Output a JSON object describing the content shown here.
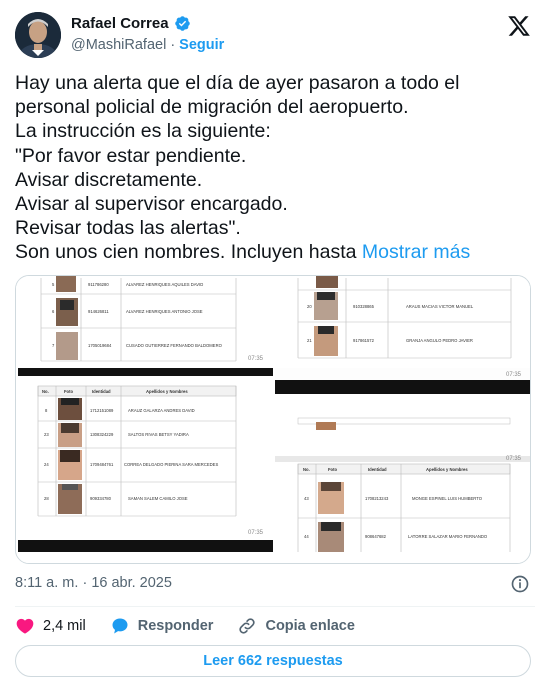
{
  "author": {
    "display_name": "Rafael Correa",
    "handle": "@MashiRafael",
    "separator": "·",
    "follow_label": "Seguir",
    "verified_color": "#1d9bf0"
  },
  "tweet": {
    "lines": [
      "Hay una alerta que el día de ayer pasaron a todo el",
      "personal policial de migración del aeropuerto.",
      "La instrucción es la siguiente:",
      "\"Por favor estar pendiente.",
      "Avisar discretamente.",
      "Avisar al supervisor encargado.",
      "Revisar todas las alertas\".",
      "Son unos cien nombres. Incluyen hasta"
    ],
    "show_more": "Mostrar más"
  },
  "media": {
    "panels": [
      {
        "timestamp": "07:35",
        "rows": [
          {
            "num": "5",
            "id": "911786280",
            "name": "ALVAREZ HENRIQUES AQUILES DAVID"
          },
          {
            "num": "6",
            "id": "914626811",
            "name": "ALVAREZ HENRIQUES ANTONIO JOSE"
          },
          {
            "num": "7",
            "id": "1705019684",
            "name": "CUSADO GUTIERREZ FERNANDO BALDOMERO"
          }
        ]
      },
      {
        "timestamp": "07:35",
        "rows": [
          {
            "num": "20",
            "id": "910328865",
            "name": "ARAUS MACIAS VICTOR MANUEL"
          },
          {
            "num": "21",
            "id": "917861572",
            "name": "GRANJA ANGULO PEDRO JAVIER"
          }
        ]
      },
      {
        "timestamp": "07:35",
        "headers": [
          "No.",
          "Foto",
          "Identidad",
          "Apellidos y Nombres"
        ],
        "rows": [
          {
            "num": "8",
            "id": "1712151089",
            "name": "ARAUZ GALARZA ANDRES DAVID"
          },
          {
            "num": "23",
            "id": "1308324229",
            "name": "SALTOS RIVAS BETSY YADIRA"
          },
          {
            "num": "24",
            "id": "1709484761",
            "name": "CORREA DELGADO PIERINA SARA MERCEDES"
          },
          {
            "num": "28",
            "id": "909334780",
            "name": "SAMAN SALEM CAMILO JOSE"
          }
        ]
      },
      {
        "timestamp": "07:35",
        "headers": [
          "No.",
          "Foto",
          "Identidad",
          "Apellidos y Nombres"
        ],
        "rows": [
          {
            "num": "43",
            "id": "1708213243",
            "name": "MONGE ESPINEL LUIS HUMBERTO"
          },
          {
            "num": "44",
            "id": "908647682",
            "name": "LATORRE SALAZAR MARIO FERNANDO"
          }
        ]
      }
    ]
  },
  "meta": {
    "time": "8:11 a. m.",
    "separator": "·",
    "date": "16 abr. 2025"
  },
  "actions": {
    "likes_count": "2,4 mil",
    "reply_label": "Responder",
    "copy_label": "Copia enlace",
    "like_color": "#f91880",
    "reply_color": "#1d9bf0"
  },
  "read_replies_label": "Leer 662 respuestas"
}
